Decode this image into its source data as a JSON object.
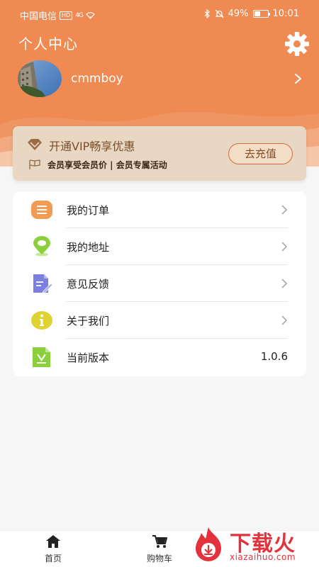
{
  "status_bar": {
    "carrier": "中国电信",
    "hd": "HD",
    "signal": "4G",
    "battery_text": "49%",
    "battery_level": 0.49,
    "time": "10:01"
  },
  "header": {
    "title": "个人中心",
    "settings_icon": "gear-icon",
    "background_color": "#ee8a52"
  },
  "profile": {
    "username": "cmmboy",
    "chevron_icon": "chevron-right-icon"
  },
  "vip": {
    "title": "开通VIP畅享优惠",
    "subtitle": "会员享受会员价 | 会员专属活动",
    "button_label": "去充值",
    "diamond_icon": "diamond-icon",
    "flag_icon": "flag-icon"
  },
  "menu": {
    "items": [
      {
        "label": "我的订单",
        "icon": "orders-icon",
        "icon_color": "#f39a54"
      },
      {
        "label": "我的地址",
        "icon": "location-icon",
        "icon_color": "#8ccf3c"
      },
      {
        "label": "意见反馈",
        "icon": "feedback-icon",
        "icon_color": "#7b7fe0"
      },
      {
        "label": "关于我们",
        "icon": "info-icon",
        "icon_color": "#dfd331"
      },
      {
        "label": "当前版本",
        "icon": "version-icon",
        "icon_color": "#8ccf3c",
        "value": "1.0.6"
      }
    ]
  },
  "tabbar": {
    "tabs": [
      {
        "label": "首页",
        "icon": "home-icon"
      },
      {
        "label": "购物车",
        "icon": "cart-icon"
      }
    ]
  },
  "watermark": {
    "text": "下载火",
    "url": "xiazaihuo.com"
  }
}
